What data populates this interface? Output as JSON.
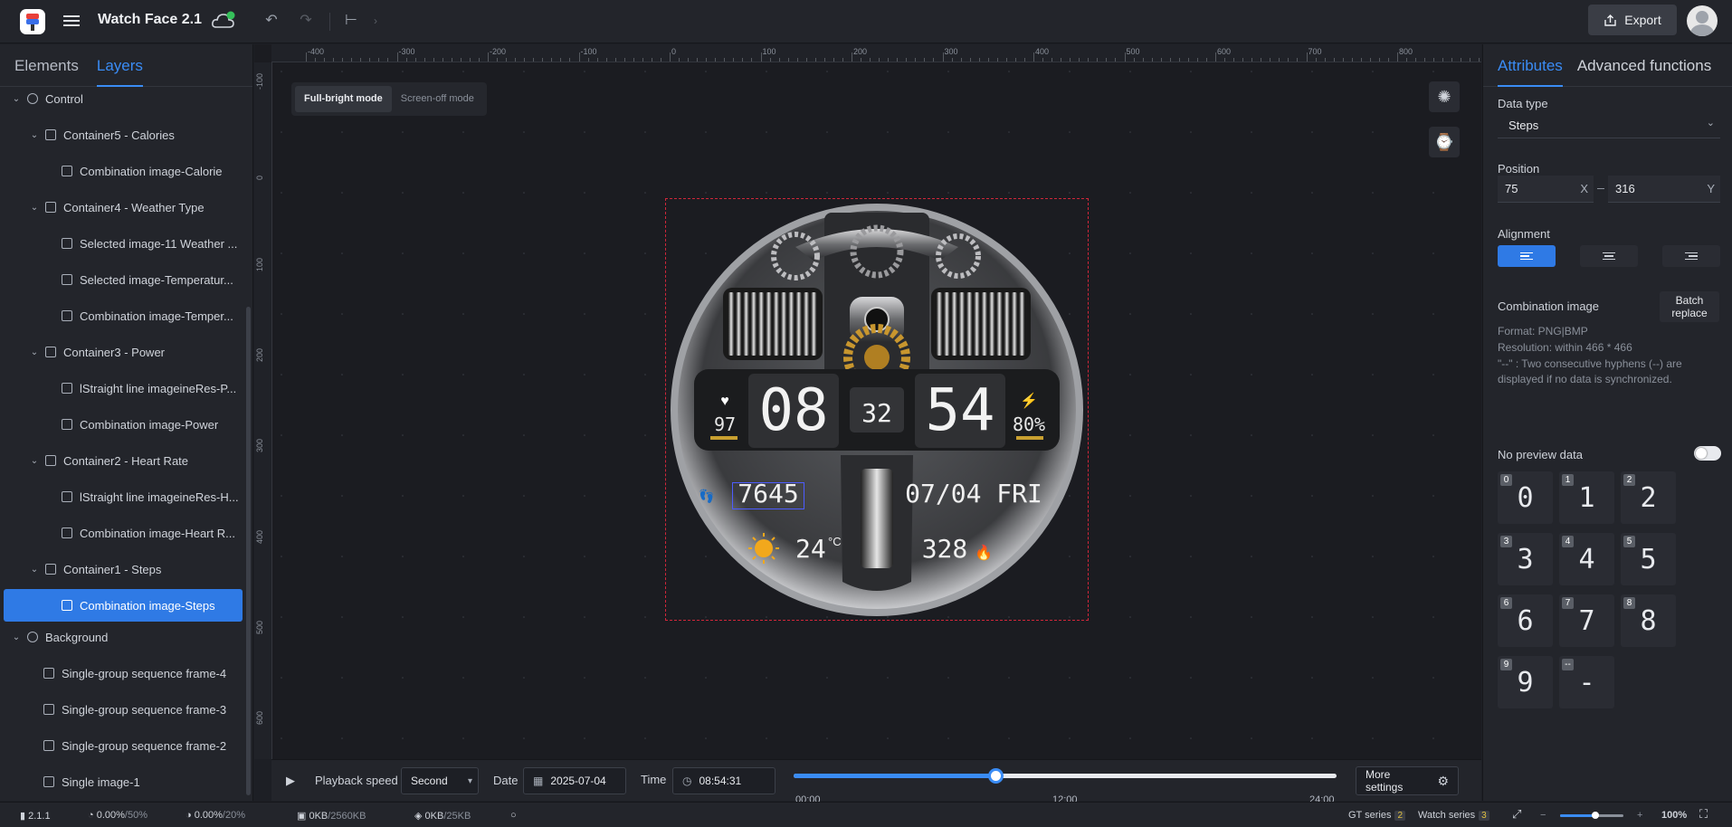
{
  "app": {
    "title": "Watch Face 2.1",
    "export_label": "Export"
  },
  "left_tabs": [
    "Elements",
    "Layers"
  ],
  "layers": [
    {
      "label": "Control",
      "icon": "cog-icon"
    },
    {
      "label": "Container5 - Calories",
      "icon": "cube-icon"
    },
    {
      "label": "Combination image-Calorie",
      "icon": "image-icon"
    },
    {
      "label": "Container4 - Weather Type",
      "icon": "cube-icon"
    },
    {
      "label": "Selected image-11 Weather ...",
      "icon": "image-select-icon"
    },
    {
      "label": "Selected image-Temperatur...",
      "icon": "image-select-icon"
    },
    {
      "label": "Combination image-Temper...",
      "icon": "image-icon"
    },
    {
      "label": "Container3 - Power",
      "icon": "cube-icon"
    },
    {
      "label": "lStraight line imageineRes-P...",
      "icon": "line-image-icon"
    },
    {
      "label": "Combination image-Power",
      "icon": "image-icon"
    },
    {
      "label": "Container2 - Heart Rate",
      "icon": "cube-icon"
    },
    {
      "label": "lStraight line imageineRes-H...",
      "icon": "line-image-icon"
    },
    {
      "label": "Combination image-Heart R...",
      "icon": "image-icon"
    },
    {
      "label": "Container1 - Steps",
      "icon": "cube-icon"
    },
    {
      "label": "Combination image-Steps",
      "icon": "image-icon"
    },
    {
      "label": "Background",
      "icon": "globe-icon"
    },
    {
      "label": "Single-group sequence frame-4",
      "icon": "frame-icon"
    },
    {
      "label": "Single-group sequence frame-3",
      "icon": "frame-icon"
    },
    {
      "label": "Single-group sequence frame-2",
      "icon": "frame-icon"
    },
    {
      "label": "Single image-1",
      "icon": "landscape-icon"
    }
  ],
  "ruler": {
    "top": [
      "-400",
      "-300",
      "-200",
      "-100",
      "0",
      "100",
      "200",
      "300",
      "400",
      "500",
      "600",
      "700",
      "800"
    ],
    "left": [
      "-100",
      "0",
      "100",
      "200",
      "300",
      "400",
      "500",
      "600"
    ]
  },
  "modes": {
    "full_bright": "Full-bright mode",
    "screen_off": "Screen-off mode"
  },
  "watch_face": {
    "heart_rate": "97",
    "hour": "08",
    "seconds": "32",
    "minute": "54",
    "battery": "80%",
    "steps": "7645",
    "date": "07/04 FRI",
    "temperature": "24",
    "temp_unit": "°C",
    "calories": "328"
  },
  "playback": {
    "speed_label": "Playback speed",
    "speed_value": "Second",
    "date_label": "Date",
    "date_value": "2025-07-04",
    "time_label": "Time",
    "time_value": "08:54:31",
    "ticks": [
      "00:00",
      "12:00",
      "24:00"
    ],
    "progress": 0.371,
    "more_settings": "More settings"
  },
  "right_tabs": [
    "Attributes",
    "Advanced functions"
  ],
  "attributes": {
    "data_type_label": "Data type",
    "data_type_value": "Steps",
    "position_label": "Position",
    "pos_x": "75",
    "pos_y": "316",
    "x_axis": "X",
    "y_axis": "Y",
    "alignment_label": "Alignment",
    "combination_label": "Combination image",
    "batch_replace": "Batch replace",
    "format": "Format:  PNG|BMP",
    "resolution": "Resolution:  within 466 * 466",
    "hyphen_note": "\"--\" : Two consecutive hyphens (--) are displayed if no data is synchronized.",
    "no_preview_label": "No preview data",
    "digits": [
      {
        "idx": "0",
        "val": "0"
      },
      {
        "idx": "1",
        "val": "1"
      },
      {
        "idx": "2",
        "val": "2"
      },
      {
        "idx": "3",
        "val": "3"
      },
      {
        "idx": "4",
        "val": "4"
      },
      {
        "idx": "5",
        "val": "5"
      },
      {
        "idx": "6",
        "val": "6"
      },
      {
        "idx": "7",
        "val": "7"
      },
      {
        "idx": "8",
        "val": "8"
      },
      {
        "idx": "9",
        "val": "9"
      },
      {
        "idx": "--",
        "val": "-"
      }
    ]
  },
  "status": {
    "version": "2.1.1",
    "cpu1": "0.00%",
    "cpu1_max": "/50%",
    "cpu2": "0.00%",
    "cpu2_max": "/20%",
    "mem1": "0KB",
    "mem1_max": "/2560KB",
    "mem2": "0KB",
    "mem2_max": "/25KB",
    "gt_series": "GT series",
    "gt_count": "2",
    "watch_series": "Watch series",
    "watch_count": "3",
    "zoom": "100%"
  },
  "colors": {
    "accent": "#3a8cf5",
    "selection": "#2f7ae5",
    "dashed_outline": "#d0263a"
  }
}
